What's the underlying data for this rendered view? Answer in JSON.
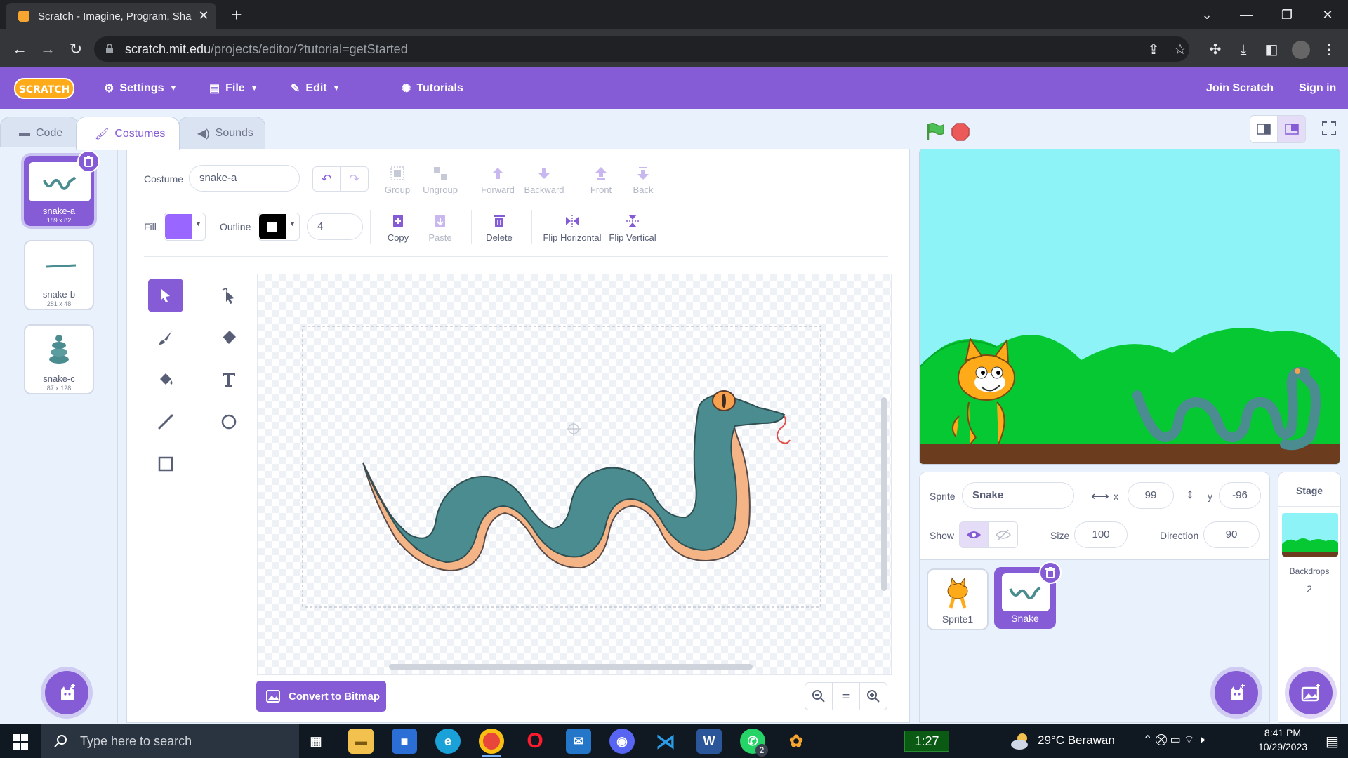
{
  "browser": {
    "tab_title": "Scratch - Imagine, Program, Sha",
    "url_host": "scratch.mit.edu",
    "url_path": "/projects/editor/?tutorial=getStarted"
  },
  "menubar": {
    "logo": "SCRATCH",
    "settings": "Settings",
    "file": "File",
    "edit": "Edit",
    "tutorials": "Tutorials",
    "join": "Join Scratch",
    "signin": "Sign in"
  },
  "tabs": {
    "code": "Code",
    "costumes": "Costumes",
    "sounds": "Sounds"
  },
  "costumes": [
    {
      "num": "1",
      "name": "snake-a",
      "size": "189 x 82"
    },
    {
      "num": "2",
      "name": "snake-b",
      "size": "281 x 48"
    },
    {
      "num": "3",
      "name": "snake-c",
      "size": "87 x 128"
    }
  ],
  "editor": {
    "costume_label": "Costume",
    "costume_name": "snake-a",
    "fill_label": "Fill",
    "fill_color": "#9966ff",
    "outline_label": "Outline",
    "outline_color": "#000000",
    "outline_width": "4",
    "group": "Group",
    "ungroup": "Ungroup",
    "forward": "Forward",
    "backward": "Backward",
    "front": "Front",
    "back": "Back",
    "copy": "Copy",
    "paste": "Paste",
    "delete": "Delete",
    "flip_h": "Flip Horizontal",
    "flip_v": "Flip Vertical",
    "convert": "Convert to Bitmap",
    "zoom_reset": "="
  },
  "sprite_info": {
    "sprite_label": "Sprite",
    "sprite_name": "Snake",
    "x_label": "x",
    "x": "99",
    "y_label": "y",
    "y": "-96",
    "show_label": "Show",
    "size_label": "Size",
    "size": "100",
    "direction_label": "Direction",
    "direction": "90"
  },
  "sprites": [
    {
      "name": "Sprite1"
    },
    {
      "name": "Snake"
    }
  ],
  "stage_panel": {
    "title": "Stage",
    "backdrops_label": "Backdrops",
    "backdrops_count": "2"
  },
  "taskbar": {
    "search_placeholder": "Type here to search",
    "timer": "1:27",
    "weather": "29°C  Berawan",
    "time": "8:41 PM",
    "date": "10/29/2023",
    "whatsapp_badge": "2"
  },
  "colors": {
    "accent": "#855cd6",
    "snake": "#4a8c90",
    "belly": "#f4b486"
  }
}
